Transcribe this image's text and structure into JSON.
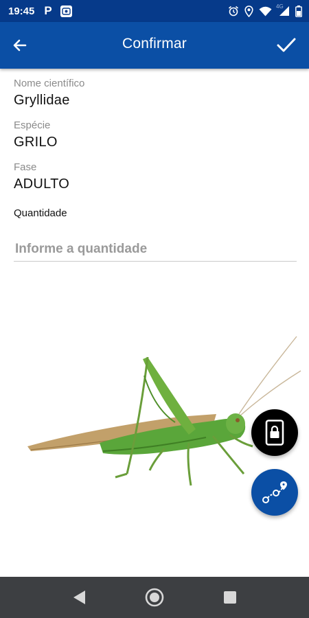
{
  "status_bar": {
    "time": "19:45",
    "p_label": "P",
    "network_label": "4G",
    "icons": [
      "parking-icon",
      "app-notification-icon",
      "alarm-icon",
      "location-icon",
      "wifi-icon",
      "signal-icon",
      "battery-icon"
    ]
  },
  "app_bar": {
    "title": "Confirmar",
    "back_icon": "arrow-back-icon",
    "confirm_icon": "check-icon",
    "color": "#0b4fa5"
  },
  "fields": {
    "scientific_name": {
      "label": "Nome científico",
      "value": "Gryllidae"
    },
    "species": {
      "label": "Espécie",
      "value": "GRILO"
    },
    "phase": {
      "label": "Fase",
      "value": "ADULTO"
    }
  },
  "quantity": {
    "label": "Quantidade",
    "placeholder": "Informe a quantidade",
    "value": ""
  },
  "fabs": {
    "lock": {
      "icon": "phone-lock-icon",
      "color": "#000000"
    },
    "route": {
      "icon": "route-icon",
      "color": "#0b4fa5"
    }
  },
  "nav_bar": {
    "icons": [
      "nav-back-icon",
      "nav-home-icon",
      "nav-recents-icon"
    ]
  }
}
